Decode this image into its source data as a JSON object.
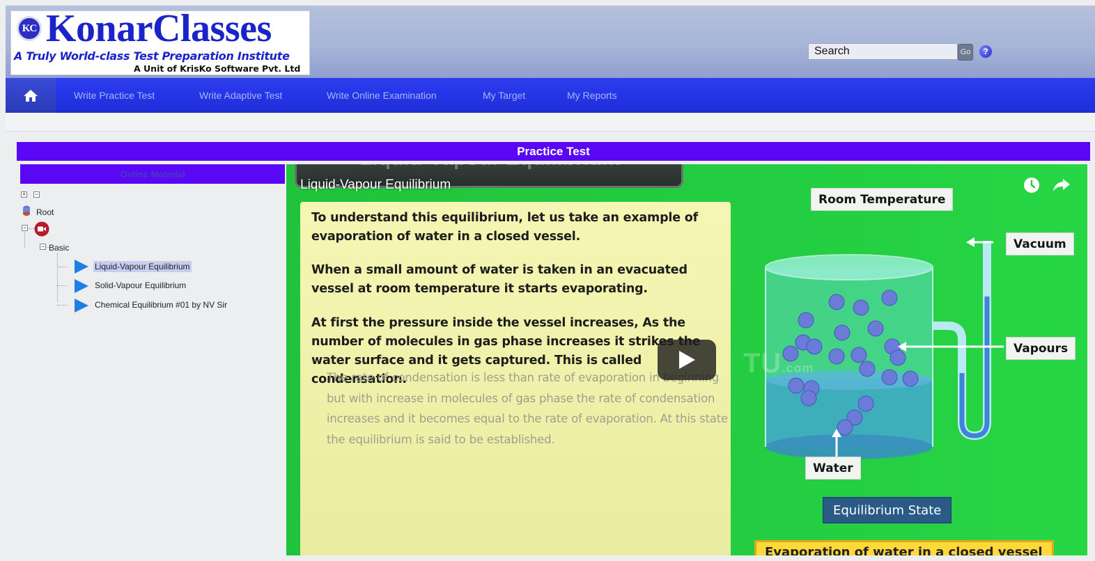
{
  "header": {
    "logo_mark": "KC",
    "logo_name": "KonarClasses",
    "tagline": "A Truly World-class Test Preparation Institute",
    "unit": "A Unit of KrisKo Software Pvt. Ltd",
    "search_value": "Search",
    "go_label": "Go",
    "help_label": "?"
  },
  "nav": {
    "home_icon": "home-icon",
    "items": [
      "Write Practice Test",
      "Write Adaptive Test",
      "Write Online Examination",
      "My Target",
      "My Reports"
    ]
  },
  "page": {
    "title": "Practice Test"
  },
  "left_panel": {
    "header": "Online Material",
    "root_label": "Root",
    "folder_label": "Basic",
    "items": [
      {
        "label": "Liquid-Vapour Equilibrium",
        "selected": true
      },
      {
        "label": "Solid-Vapour Equilibrium",
        "selected": false
      },
      {
        "label": "Chemical Equilibrium #01 by NV Sir",
        "selected": false
      }
    ]
  },
  "video": {
    "banner_text": "Liquid-Vapour Equilibrium",
    "title": "Liquid-Vapour Equilibrium",
    "paragraphs": [
      "To understand this equilibrium, let us take an example of evaporation of water in a closed vessel.",
      "When a small amount of water is taken in an evacuated vessel at room temperature it starts evaporating.",
      "At first the pressure inside the vessel increases, As the number of molecules in gas phase increases it strikes the water surface and it gets captured. This is called condensation."
    ],
    "faded_paragraph": "The rate of condensation is less than rate of evaporation in beginning but with increase in molecules of gas phase the rate of condensation increases and it becomes equal to the rate of evaporation. At this state the equilibrium is said to be established.",
    "labels": {
      "room_temperature": "Room Temperature",
      "vacuum": "Vacuum",
      "vapours": "Vapours",
      "water": "Water",
      "equilibrium_state": "Equilibrium State",
      "caption": "Evaporation of water in a closed vessel"
    },
    "watermark": "TU",
    "watermark_small": ".com"
  },
  "colors": {
    "brand_blue": "#1b24c8",
    "nav_blue": "#2536e8",
    "title_purple": "#5a07f6",
    "video_green": "#23cc41"
  }
}
